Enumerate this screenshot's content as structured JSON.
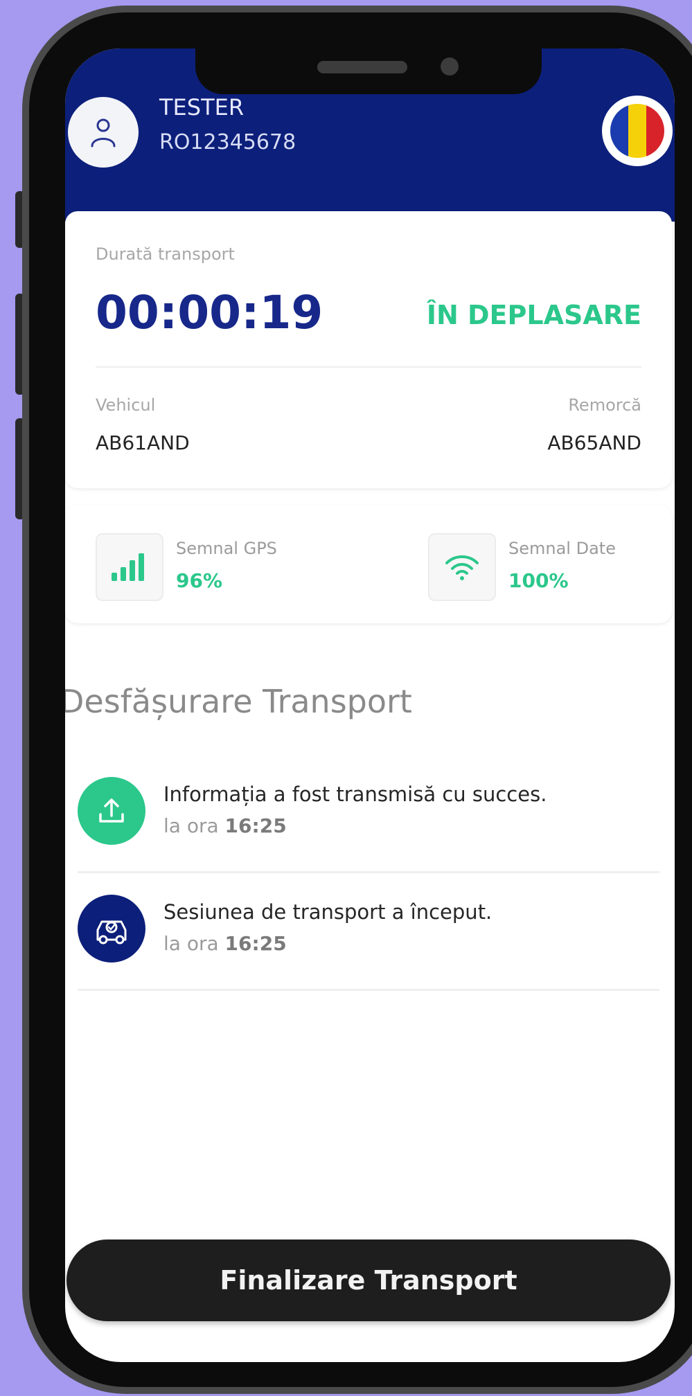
{
  "header": {
    "user_name": "TESTER",
    "user_id": "RO12345678",
    "flag_colors": [
      "#1a3cae",
      "#f5d10a",
      "#d8232a"
    ]
  },
  "transport": {
    "duration_label": "Durată transport",
    "duration_value": "00:00:19",
    "status": "ÎN DEPLASARE",
    "vehicle_label": "Vehicul",
    "vehicle_value": "AB61AND",
    "trailer_label": "Remorcă",
    "trailer_value": "AB65AND"
  },
  "signals": {
    "gps_label": "Semnal GPS",
    "gps_value": "96%",
    "data_label": "Semnal Date",
    "data_value": "100%"
  },
  "events_section": {
    "title": "Desfășurare Transport",
    "items": [
      {
        "text": "Informația a fost transmisă cu succes.",
        "time_prefix": "la ora",
        "time": "16:25",
        "icon": "upload-icon",
        "color": "#2bc78b"
      },
      {
        "text": "Sesiunea de transport a început.",
        "time_prefix": "la ora",
        "time": "16:25",
        "icon": "car-session-icon",
        "color": "#0c1f7a"
      }
    ]
  },
  "footer": {
    "finish_button": "Finalizare Transport"
  },
  "colors": {
    "primary": "#0c1f7a",
    "accent": "#2bc78b",
    "background": "#a59af0"
  }
}
